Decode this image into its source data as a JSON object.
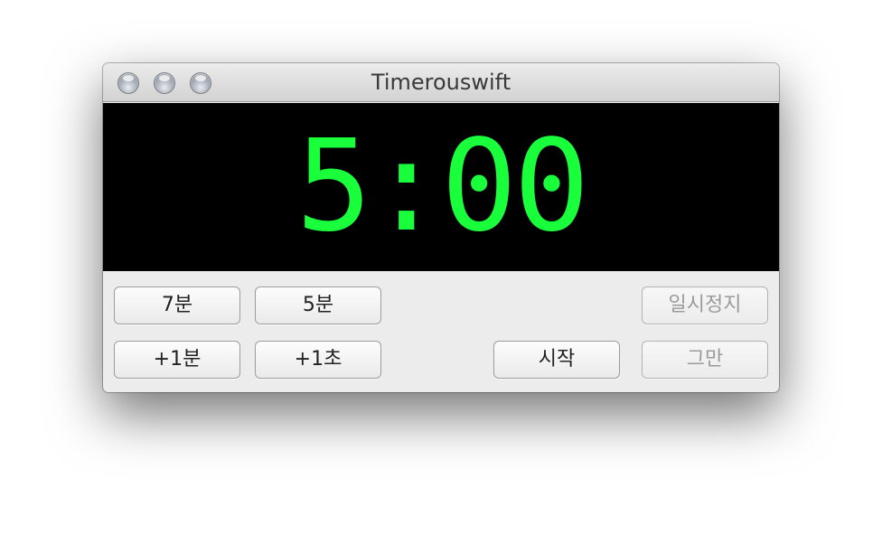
{
  "window": {
    "title": "Timerouswift"
  },
  "display": {
    "time": "5:00",
    "color": "#1aff3c"
  },
  "buttons": {
    "seven_min": "7분",
    "five_min": "5분",
    "plus_one_min": "+1분",
    "plus_one_sec": "+1초",
    "start": "시작",
    "pause": "일시정지",
    "stop": "그만"
  },
  "state": {
    "pause_enabled": false,
    "stop_enabled": false
  }
}
